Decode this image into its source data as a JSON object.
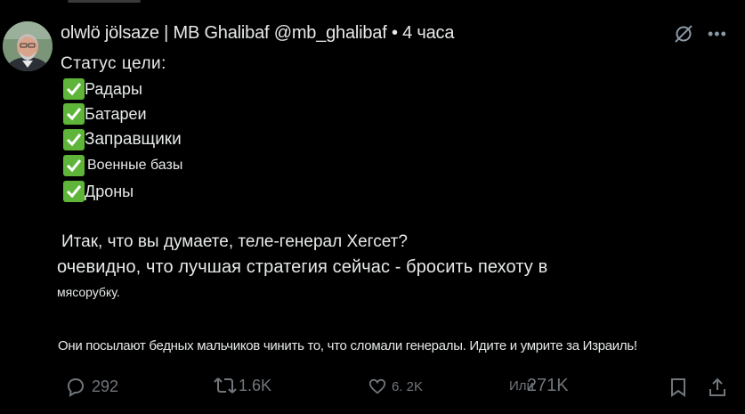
{
  "tweet": {
    "display_name": "ᴏlwlö jölsaze | MB Ghalibaf",
    "handle": "@mb_ghalibaf",
    "separator": "•",
    "timestamp": "4 часа",
    "status_title": "Статус цели:",
    "checklist": [
      {
        "label": "Радары"
      },
      {
        "label": "Батареи"
      },
      {
        "label": "Заправщики"
      },
      {
        "label": "Военные базы"
      },
      {
        "label": "Дроны"
      }
    ],
    "question": "Итак, что вы думаете, теле-генерал Хегсет?",
    "strategy": "очевидно, что лучшая стратегия сейчас - бросить пехоту в",
    "strategy_end": "мясорубку.",
    "closing": "Они посылают бедных мальчиков чинить то, что сломали генералы. Идите и умрите за Израиль!"
  },
  "actions": {
    "replies": "292",
    "reposts": "1.6K",
    "likes": "6. 2K",
    "views_prefix": "Или",
    "views": "271K"
  },
  "colors": {
    "background": "#000000",
    "text": "#e7e9ea",
    "muted": "#71767b",
    "check": "#5eb539"
  }
}
